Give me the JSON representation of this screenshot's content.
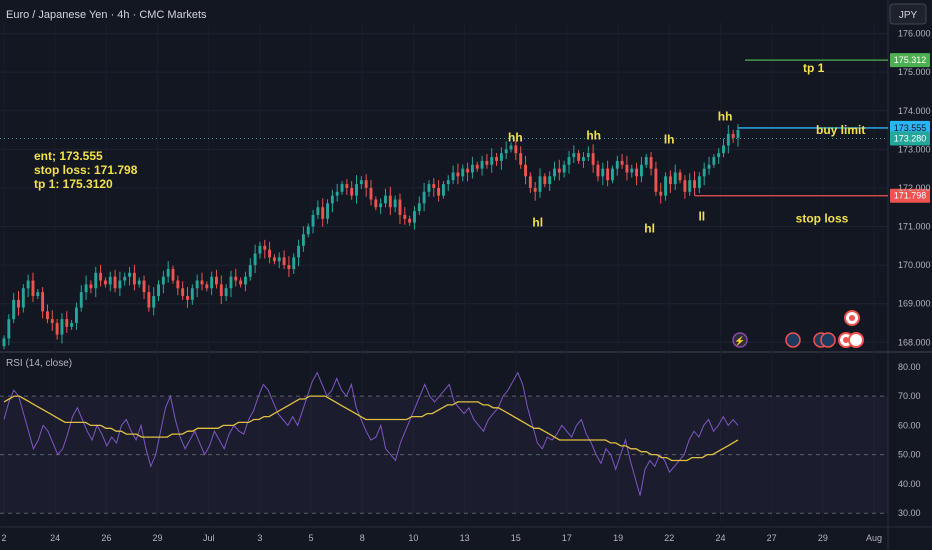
{
  "header": {
    "title": "Euro / Japanese Yen · 4h · CMC Markets",
    "currency": "JPY"
  },
  "notes": [
    "ent; 173.555",
    "stop loss: 171.798",
    "tp 1: 175.3120"
  ],
  "colors": {
    "up": "#26a69a",
    "down": "#ef5350",
    "annotation": "#f2e14c",
    "rsi": "#7e57c2",
    "rsi_ma": "#e0c040",
    "tp": "#4caf50",
    "entry": "#29b6f6",
    "stop": "#ef5350"
  },
  "chart_data": [
    {
      "type": "candlestick",
      "y_ticks": [
        168,
        169,
        170,
        171,
        172,
        173,
        174,
        175,
        176
      ],
      "y_tick_labels": [
        "168.000",
        "169.000",
        "170.000",
        "171.000",
        "172.000",
        "173.000",
        "174.000",
        "175.000",
        "176.000"
      ],
      "ylim": [
        167.8,
        176.3
      ],
      "x_ticks": [
        "2",
        "24",
        "26",
        "29",
        "Jul",
        "3",
        "5",
        "8",
        "10",
        "13",
        "15",
        "17",
        "19",
        "22",
        "24",
        "27",
        "29",
        "Aug"
      ],
      "levels": [
        {
          "name": "tp 1",
          "value": 175.312,
          "label": "175.312"
        },
        {
          "name": "buy limit",
          "value": 173.555,
          "label": "173.555"
        },
        {
          "name": "last",
          "value": 173.28,
          "label": "173.280"
        },
        {
          "name": "stop loss",
          "value": 171.798,
          "label": "171.798"
        }
      ],
      "annotations": [
        {
          "text": "hh",
          "x": 0.553,
          "y": 173.2
        },
        {
          "text": "hh",
          "x": 0.637,
          "y": 173.25
        },
        {
          "text": "lh",
          "x": 0.718,
          "y": 173.15
        },
        {
          "text": "hh",
          "x": 0.778,
          "y": 173.75
        },
        {
          "text": "hl",
          "x": 0.577,
          "y": 171.0
        },
        {
          "text": "hl",
          "x": 0.697,
          "y": 170.85
        },
        {
          "text": "ll",
          "x": 0.753,
          "y": 171.15
        },
        {
          "text": "tp 1",
          "x": 0.873,
          "y": 175.0
        },
        {
          "text": "buy limit",
          "x": 0.902,
          "y": 173.4
        },
        {
          "text": "stop loss",
          "x": 0.882,
          "y": 171.1
        }
      ],
      "closes": [
        168.1,
        168.6,
        169.1,
        168.9,
        169.4,
        169.6,
        169.2,
        169.3,
        168.8,
        168.6,
        168.5,
        168.2,
        168.6,
        168.4,
        168.5,
        168.9,
        169.3,
        169.5,
        169.4,
        169.8,
        169.6,
        169.5,
        169.7,
        169.4,
        169.6,
        169.7,
        169.8,
        169.5,
        169.6,
        169.3,
        168.9,
        169.2,
        169.5,
        169.7,
        169.9,
        169.6,
        169.4,
        169.2,
        169.1,
        169.4,
        169.6,
        169.5,
        169.4,
        169.7,
        169.5,
        169.2,
        169.4,
        169.7,
        169.6,
        169.5,
        169.7,
        170.0,
        170.3,
        170.5,
        170.4,
        170.2,
        170.1,
        170.2,
        170.0,
        169.9,
        170.2,
        170.5,
        170.8,
        171.0,
        171.3,
        171.5,
        171.2,
        171.6,
        171.8,
        171.9,
        172.1,
        172.0,
        171.8,
        172.1,
        172.2,
        172.0,
        171.7,
        171.5,
        171.6,
        171.8,
        171.5,
        171.7,
        171.3,
        171.2,
        171.1,
        171.4,
        171.6,
        171.9,
        172.1,
        172.0,
        171.8,
        172.1,
        172.2,
        172.4,
        172.3,
        172.5,
        172.4,
        172.6,
        172.5,
        172.7,
        172.6,
        172.8,
        172.7,
        172.9,
        173.0,
        173.1,
        172.9,
        172.6,
        172.3,
        172.0,
        171.9,
        172.3,
        172.1,
        172.3,
        172.5,
        172.4,
        172.6,
        172.8,
        172.9,
        172.7,
        172.8,
        172.9,
        172.6,
        172.3,
        172.5,
        172.2,
        172.5,
        172.7,
        172.6,
        172.4,
        172.5,
        172.3,
        172.6,
        172.8,
        172.5,
        171.9,
        171.8,
        172.3,
        172.1,
        172.4,
        172.2,
        171.9,
        172.2,
        172.0,
        172.3,
        172.5,
        172.6,
        172.8,
        172.9,
        173.1,
        173.4,
        173.3,
        173.5
      ]
    },
    {
      "type": "line",
      "title": "RSI (14, close)",
      "y_ticks": [
        30,
        40,
        50,
        60,
        70,
        80
      ],
      "y_tick_labels": [
        "30.00",
        "40.00",
        "50.00",
        "60.00",
        "70.00",
        "80.00"
      ],
      "bands": [
        30,
        50,
        70
      ],
      "ylim": [
        27,
        83
      ],
      "series": [
        {
          "name": "RSI",
          "values": [
            62,
            68,
            72,
            70,
            64,
            58,
            52,
            55,
            60,
            58,
            54,
            50,
            52,
            57,
            63,
            66,
            62,
            58,
            55,
            60,
            57,
            53,
            56,
            54,
            60,
            62,
            58,
            55,
            60,
            52,
            46,
            50,
            58,
            66,
            70,
            62,
            56,
            52,
            55,
            58,
            54,
            50,
            53,
            58,
            55,
            52,
            57,
            60,
            58,
            57,
            62,
            65,
            70,
            74,
            72,
            68,
            64,
            62,
            60,
            63,
            60,
            65,
            70,
            75,
            78,
            74,
            70,
            72,
            76,
            72,
            70,
            74,
            66,
            62,
            58,
            55,
            56,
            60,
            52,
            50,
            48,
            54,
            58,
            62,
            66,
            70,
            74,
            70,
            68,
            70,
            72,
            74,
            68,
            66,
            64,
            66,
            62,
            60,
            58,
            62,
            64,
            66,
            70,
            72,
            75,
            78,
            74,
            66,
            60,
            54,
            52,
            56,
            55,
            57,
            60,
            58,
            56,
            60,
            62,
            57,
            54,
            50,
            47,
            52,
            50,
            45,
            50,
            55,
            48,
            42,
            36,
            45,
            48,
            46,
            50,
            48,
            44,
            46,
            48,
            50,
            55,
            58,
            56,
            60,
            62,
            58,
            60,
            63,
            60,
            62,
            60
          ]
        },
        {
          "name": "RSI MA",
          "values": [
            68,
            69,
            70,
            70,
            69,
            68,
            67,
            66,
            65,
            64,
            63,
            62,
            61,
            61,
            61,
            61,
            61,
            60,
            60,
            60,
            59,
            59,
            58,
            58,
            57,
            57,
            57,
            56,
            56,
            56,
            56,
            56,
            56,
            57,
            57,
            57,
            58,
            58,
            59,
            59,
            59,
            59,
            59,
            60,
            60,
            60,
            61,
            61,
            61,
            62,
            62,
            63,
            63,
            64,
            65,
            66,
            67,
            68,
            69,
            69,
            70,
            70,
            70,
            70,
            69,
            68,
            67,
            66,
            65,
            64,
            63,
            62,
            62,
            62,
            62,
            62,
            62,
            62,
            62,
            62,
            63,
            63,
            63,
            64,
            64,
            65,
            66,
            67,
            67,
            68,
            68,
            68,
            68,
            68,
            67,
            67,
            66,
            66,
            65,
            64,
            63,
            62,
            61,
            60,
            59,
            59,
            58,
            57,
            56,
            55,
            55,
            55,
            55,
            55,
            55,
            55,
            55,
            55,
            55,
            54,
            54,
            53,
            53,
            52,
            52,
            51,
            51,
            50,
            50,
            49,
            49,
            48,
            48,
            48,
            48,
            49,
            49,
            49,
            50,
            50,
            51,
            52,
            53,
            54,
            55
          ]
        }
      ]
    }
  ]
}
